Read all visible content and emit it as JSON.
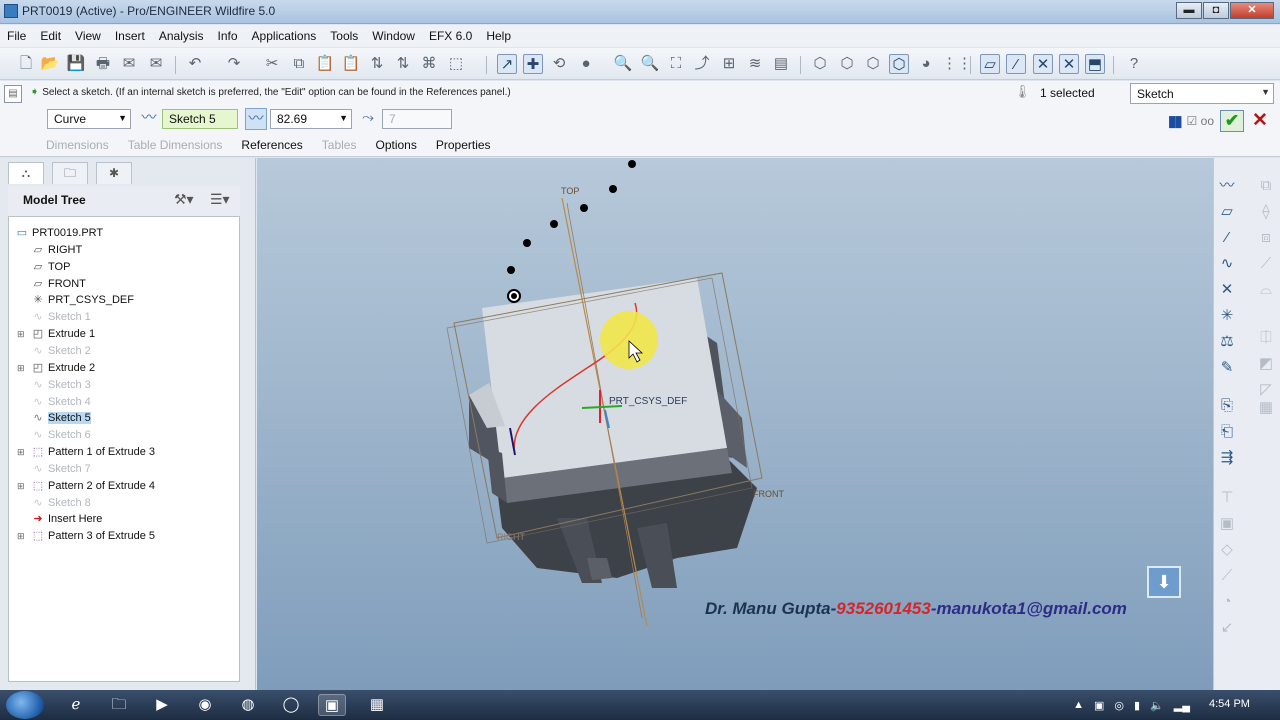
{
  "window": {
    "title": "PRT0019 (Active) - Pro/ENGINEER Wildfire 5.0",
    "minimize": "▬",
    "maximize": "◘",
    "close": "✕"
  },
  "menu": [
    "File",
    "Edit",
    "View",
    "Insert",
    "Analysis",
    "Info",
    "Applications",
    "Tools",
    "Window",
    "EFX 6.0",
    "Help"
  ],
  "dashboard": {
    "message": "Select a sketch. (If an internal sketch is preferred, the \"Edit\" option can be found in the References panel.)",
    "selected_count": "1 selected",
    "filter_value": "Sketch",
    "curve_type": "Curve",
    "sketch_field": "Sketch 5",
    "depth_value": "82.69",
    "spin_value": "7",
    "tabs": [
      {
        "label": "Dimensions",
        "enabled": false
      },
      {
        "label": "Table Dimensions",
        "enabled": false
      },
      {
        "label": "References",
        "enabled": true
      },
      {
        "label": "Tables",
        "enabled": false
      },
      {
        "label": "Options",
        "enabled": true
      },
      {
        "label": "Properties",
        "enabled": true
      }
    ]
  },
  "model_tree": {
    "header": "Model Tree",
    "items": [
      {
        "label": "PRT0019.PRT",
        "icon": "part-icon",
        "dim": false,
        "indent": 0,
        "expander": false
      },
      {
        "label": "RIGHT",
        "icon": "datum-plane-icon",
        "dim": false,
        "indent": 1,
        "expander": false
      },
      {
        "label": "TOP",
        "icon": "datum-plane-icon",
        "dim": false,
        "indent": 1,
        "expander": false
      },
      {
        "label": "FRONT",
        "icon": "datum-plane-icon",
        "dim": false,
        "indent": 1,
        "expander": false
      },
      {
        "label": "PRT_CSYS_DEF",
        "icon": "csys-icon",
        "dim": false,
        "indent": 1,
        "expander": false
      },
      {
        "label": "Sketch 1",
        "icon": "sketch-icon",
        "dim": true,
        "indent": 1,
        "expander": false
      },
      {
        "label": "Extrude 1",
        "icon": "extrude-icon",
        "dim": false,
        "indent": 1,
        "expander": true
      },
      {
        "label": "Sketch 2",
        "icon": "sketch-icon",
        "dim": true,
        "indent": 1,
        "expander": false
      },
      {
        "label": "Extrude 2",
        "icon": "extrude-icon",
        "dim": false,
        "indent": 1,
        "expander": true
      },
      {
        "label": "Sketch 3",
        "icon": "sketch-icon",
        "dim": true,
        "indent": 1,
        "expander": false
      },
      {
        "label": "Sketch 4",
        "icon": "sketch-icon",
        "dim": true,
        "indent": 1,
        "expander": false
      },
      {
        "label": "Sketch 5",
        "icon": "sketch-icon",
        "dim": false,
        "indent": 1,
        "expander": false,
        "selected": true
      },
      {
        "label": "Sketch 6",
        "icon": "sketch-icon",
        "dim": true,
        "indent": 1,
        "expander": false
      },
      {
        "label": "Pattern 1 of Extrude 3",
        "icon": "pattern-icon",
        "dim": false,
        "indent": 1,
        "expander": true
      },
      {
        "label": "Sketch 7",
        "icon": "sketch-icon",
        "dim": true,
        "indent": 1,
        "expander": false
      },
      {
        "label": "Pattern 2 of Extrude 4",
        "icon": "pattern-icon",
        "dim": false,
        "indent": 1,
        "expander": true
      },
      {
        "label": "Sketch 8",
        "icon": "sketch-icon",
        "dim": true,
        "indent": 1,
        "expander": false
      },
      {
        "label": "Insert Here",
        "icon": "insert-here-icon",
        "dim": false,
        "indent": 1,
        "expander": false
      },
      {
        "label": "Pattern 3 of Extrude 5",
        "icon": "pattern-icon",
        "dim": false,
        "indent": 1,
        "expander": true
      }
    ]
  },
  "viewport": {
    "labels": {
      "top": "TOP",
      "front": "FRONT",
      "right": "RIGHT",
      "csys": "PRT_CSYS_DEF"
    }
  },
  "watermark": {
    "name": "Dr. Manu Gupta-",
    "phone": "9352601453",
    "email": "-manukota1@gmail.com"
  },
  "taskbar": {
    "clock": "4:54 PM"
  }
}
